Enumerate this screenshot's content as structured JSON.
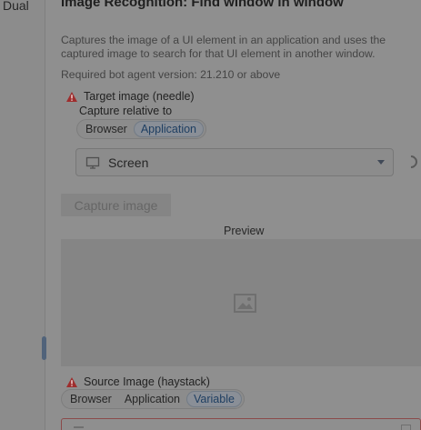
{
  "sidebar": {
    "tab_label": "Dual"
  },
  "header": {
    "title": "Image Recognition: Find window in window"
  },
  "main": {
    "description": "Captures the image of a UI element in an application and uses the captured image to search for that UI element in another window.",
    "requirement": "Required bot agent version: 21.210 or above",
    "target_image": {
      "label": "Target image (needle)",
      "capture_relative_label": "Capture relative to",
      "capture_relative_options": [
        "Browser",
        "Application"
      ],
      "selected_option": "Application",
      "window_select_value": "Screen",
      "capture_button_label": "Capture image",
      "preview_label": "Preview"
    },
    "source_image": {
      "label": "Source Image (haystack)",
      "options": [
        "Browser",
        "Application",
        "Variable"
      ],
      "selected_option": "Variable"
    }
  },
  "icons": {
    "warning": "warning-icon",
    "monitor": "monitor-icon",
    "dropdown": "chevron-down-icon",
    "loading": "spinner-icon",
    "preview": "image-icon"
  },
  "colors": {
    "background": "#8f8f8f",
    "selected_segment_text": "#1f3f62",
    "warning": "#9e2d2d",
    "scroll_thumb": "#51637a"
  }
}
